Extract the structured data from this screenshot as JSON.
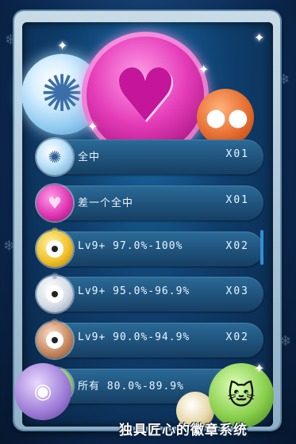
{
  "hero": {
    "left_badge_icon": "ice-star-icon",
    "center_badge_icon": "pink-heart-icon",
    "right_badge_icon": "orange-monster-icon"
  },
  "rows": [
    {
      "icon": "ice-star-badge-icon",
      "label": "全中",
      "count": "X01"
    },
    {
      "icon": "pink-heart-badge-icon",
      "label": "差一个全中",
      "count": "X01"
    },
    {
      "icon": "gold-crown-badge-icon",
      "label": "Lv9+ 97.0%-100%",
      "count": "X02"
    },
    {
      "icon": "silver-crown-badge-icon",
      "label": "Lv9+ 95.0%-96.9%",
      "count": "X03"
    },
    {
      "icon": "bronze-crown-badge-icon",
      "label": "Lv9+ 90.0%-94.9%",
      "count": "X02"
    },
    {
      "icon": "green-badge-icon",
      "label": "所有 80.0%-89.9%",
      "count": ""
    }
  ],
  "footer": {
    "caption": "独具匠心的徽章系统"
  },
  "colors": {
    "background": "#0d2c56",
    "row": "#1f557f",
    "accent_pink": "#e43bb8",
    "accent_gold": "#f1c22b"
  }
}
